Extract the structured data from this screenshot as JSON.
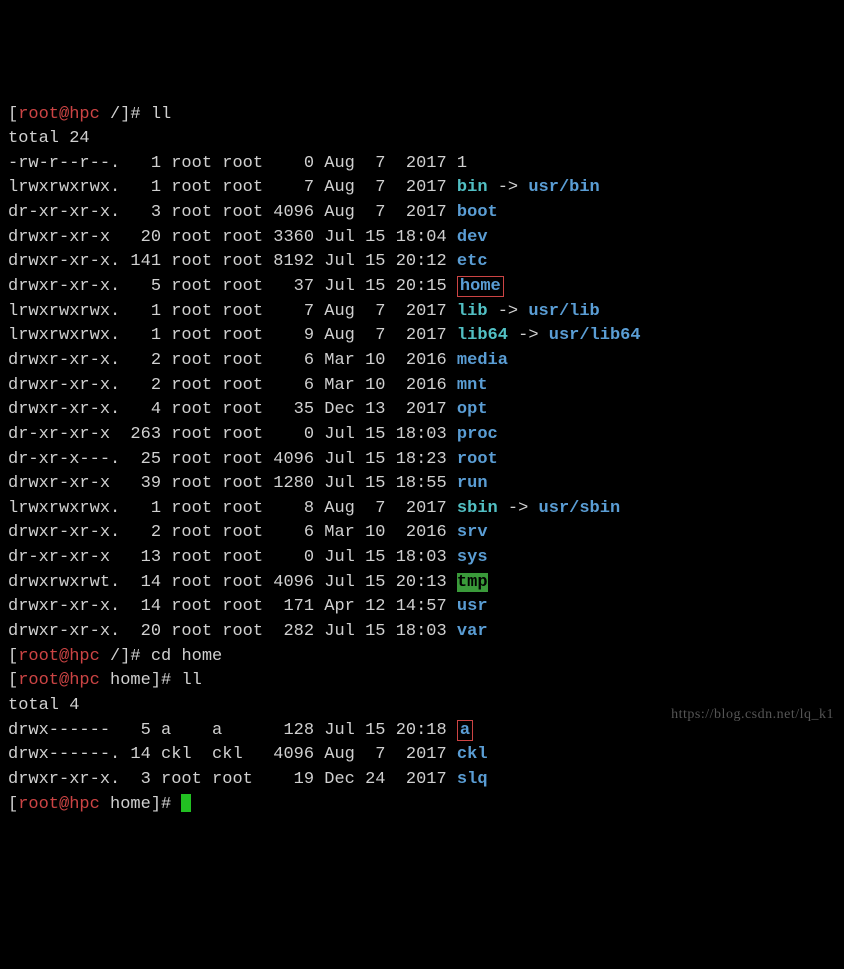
{
  "prompt1": {
    "user": "root",
    "host": "hpc",
    "path": "/",
    "cmd": "ll"
  },
  "total1": "total 24",
  "files1": [
    {
      "perm": "-rw-r--r--.",
      "lnk": "1",
      "own": "root",
      "grp": "root",
      "size": "0",
      "mon": "Aug",
      "day": "7",
      "time": "2017",
      "name": "1",
      "type": "plain"
    },
    {
      "perm": "lrwxrwxrwx.",
      "lnk": "1",
      "own": "root",
      "grp": "root",
      "size": "7",
      "mon": "Aug",
      "day": "7",
      "time": "2017",
      "name": "bin",
      "type": "link",
      "arrow": "->",
      "target": "usr/bin"
    },
    {
      "perm": "dr-xr-xr-x.",
      "lnk": "3",
      "own": "root",
      "grp": "root",
      "size": "4096",
      "mon": "Aug",
      "day": "7",
      "time": "2017",
      "name": "boot",
      "type": "dir"
    },
    {
      "perm": "drwxr-xr-x",
      "lnk": "20",
      "own": "root",
      "grp": "root",
      "size": "3360",
      "mon": "Jul",
      "day": "15",
      "time": "18:04",
      "name": "dev",
      "type": "dir"
    },
    {
      "perm": "drwxr-xr-x.",
      "lnk": "141",
      "own": "root",
      "grp": "root",
      "size": "8192",
      "mon": "Jul",
      "day": "15",
      "time": "20:12",
      "name": "etc",
      "type": "dir"
    },
    {
      "perm": "drwxr-xr-x.",
      "lnk": "5",
      "own": "root",
      "grp": "root",
      "size": "37",
      "mon": "Jul",
      "day": "15",
      "time": "20:15",
      "name": "home",
      "type": "dirbox"
    },
    {
      "perm": "lrwxrwxrwx.",
      "lnk": "1",
      "own": "root",
      "grp": "root",
      "size": "7",
      "mon": "Aug",
      "day": "7",
      "time": "2017",
      "name": "lib",
      "type": "link",
      "arrow": "->",
      "target": "usr/lib"
    },
    {
      "perm": "lrwxrwxrwx.",
      "lnk": "1",
      "own": "root",
      "grp": "root",
      "size": "9",
      "mon": "Aug",
      "day": "7",
      "time": "2017",
      "name": "lib64",
      "type": "link",
      "arrow": "->",
      "target": "usr/lib64"
    },
    {
      "perm": "drwxr-xr-x.",
      "lnk": "2",
      "own": "root",
      "grp": "root",
      "size": "6",
      "mon": "Mar",
      "day": "10",
      "time": "2016",
      "name": "media",
      "type": "dir"
    },
    {
      "perm": "drwxr-xr-x.",
      "lnk": "2",
      "own": "root",
      "grp": "root",
      "size": "6",
      "mon": "Mar",
      "day": "10",
      "time": "2016",
      "name": "mnt",
      "type": "dir"
    },
    {
      "perm": "drwxr-xr-x.",
      "lnk": "4",
      "own": "root",
      "grp": "root",
      "size": "35",
      "mon": "Dec",
      "day": "13",
      "time": "2017",
      "name": "opt",
      "type": "dir"
    },
    {
      "perm": "dr-xr-xr-x",
      "lnk": "263",
      "own": "root",
      "grp": "root",
      "size": "0",
      "mon": "Jul",
      "day": "15",
      "time": "18:03",
      "name": "proc",
      "type": "dir"
    },
    {
      "perm": "dr-xr-x---.",
      "lnk": "25",
      "own": "root",
      "grp": "root",
      "size": "4096",
      "mon": "Jul",
      "day": "15",
      "time": "18:23",
      "name": "root",
      "type": "dir"
    },
    {
      "perm": "drwxr-xr-x",
      "lnk": "39",
      "own": "root",
      "grp": "root",
      "size": "1280",
      "mon": "Jul",
      "day": "15",
      "time": "18:55",
      "name": "run",
      "type": "dir"
    },
    {
      "perm": "lrwxrwxrwx.",
      "lnk": "1",
      "own": "root",
      "grp": "root",
      "size": "8",
      "mon": "Aug",
      "day": "7",
      "time": "2017",
      "name": "sbin",
      "type": "link",
      "arrow": "->",
      "target": "usr/sbin"
    },
    {
      "perm": "drwxr-xr-x.",
      "lnk": "2",
      "own": "root",
      "grp": "root",
      "size": "6",
      "mon": "Mar",
      "day": "10",
      "time": "2016",
      "name": "srv",
      "type": "dir"
    },
    {
      "perm": "dr-xr-xr-x",
      "lnk": "13",
      "own": "root",
      "grp": "root",
      "size": "0",
      "mon": "Jul",
      "day": "15",
      "time": "18:03",
      "name": "sys",
      "type": "dir"
    },
    {
      "perm": "drwxrwxrwt.",
      "lnk": "14",
      "own": "root",
      "grp": "root",
      "size": "4096",
      "mon": "Jul",
      "day": "15",
      "time": "20:13",
      "name": "tmp",
      "type": "tmp"
    },
    {
      "perm": "drwxr-xr-x.",
      "lnk": "14",
      "own": "root",
      "grp": "root",
      "size": "171",
      "mon": "Apr",
      "day": "12",
      "time": "14:57",
      "name": "usr",
      "type": "dir"
    },
    {
      "perm": "drwxr-xr-x.",
      "lnk": "20",
      "own": "root",
      "grp": "root",
      "size": "282",
      "mon": "Jul",
      "day": "15",
      "time": "18:03",
      "name": "var",
      "type": "dir"
    }
  ],
  "prompt2": {
    "user": "root",
    "host": "hpc",
    "path": "/",
    "cmd": "cd home"
  },
  "prompt3": {
    "user": "root",
    "host": "hpc",
    "path": "home",
    "cmd": "ll"
  },
  "total2": "total 4",
  "files2": [
    {
      "perm": "drwx------",
      "lnk": "5",
      "own": "a",
      "grp": "a",
      "size": "128",
      "mon": "Jul",
      "day": "15",
      "time": "20:18",
      "name": "a",
      "type": "dirbox"
    },
    {
      "perm": "drwx------.",
      "lnk": "14",
      "own": "ckl",
      "grp": "ckl",
      "size": "4096",
      "mon": "Aug",
      "day": "7",
      "time": "2017",
      "name": "ckl",
      "type": "dir"
    },
    {
      "perm": "drwxr-xr-x.",
      "lnk": "3",
      "own": "root",
      "grp": "root",
      "size": "19",
      "mon": "Dec",
      "day": "24",
      "time": "2017",
      "name": "slq",
      "type": "dir"
    }
  ],
  "prompt4": {
    "user": "root",
    "host": "hpc",
    "path": "home",
    "cmd": ""
  },
  "watermark": "https://blog.csdn.net/lq_k1"
}
